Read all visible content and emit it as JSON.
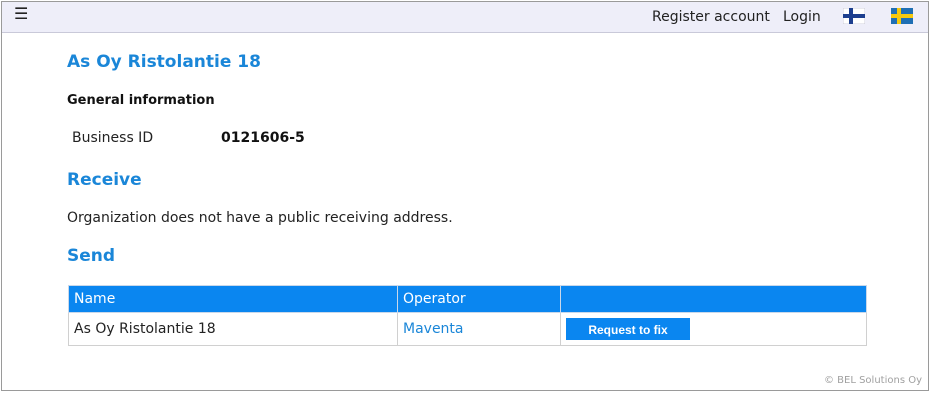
{
  "topbar": {
    "menu_icon": "☰",
    "register_label": "Register account",
    "login_label": "Login",
    "flags": [
      "finland-flag-icon",
      "sweden-flag-icon"
    ]
  },
  "org": {
    "title": "As Oy Ristolantie 18",
    "general_heading": "General information",
    "business_id_label": "Business ID",
    "business_id_value": "0121606-5"
  },
  "receive": {
    "heading": "Receive",
    "text": "Organization does not have a public receiving address."
  },
  "send": {
    "heading": "Send",
    "columns": [
      "Name",
      "Operator",
      ""
    ],
    "rows": [
      {
        "name": "As Oy Ristolantie 18",
        "operator": "Maventa",
        "action_label": "Request to fix"
      }
    ]
  },
  "footer": {
    "copyright": "© BEL Solutions Oy"
  },
  "colors": {
    "accent": "#1a86d8",
    "header_bg": "#0a86f0",
    "topbar_bg": "#eeeef9"
  }
}
